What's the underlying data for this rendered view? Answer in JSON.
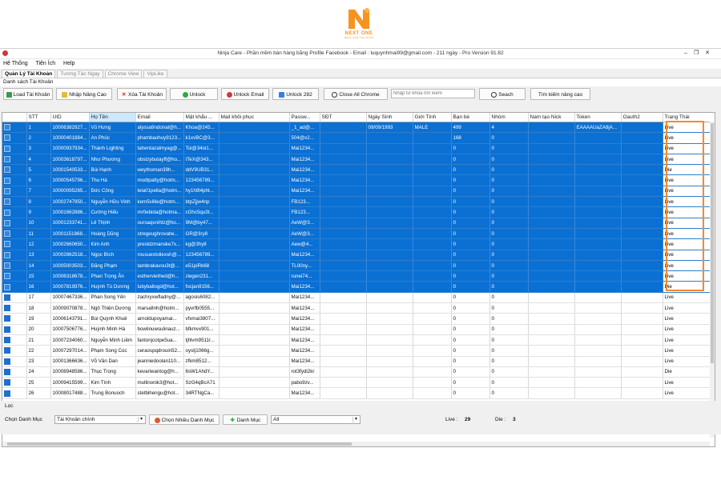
{
  "logo": {
    "brand": "NEXT ONE",
    "tagline": "NEXT ONE SOLUTION"
  },
  "window": {
    "title": "Ninja Care - Phần mềm bán hàng bằng Profile Facebook - Email : luquynhmai99@gmail.com - 211 ngày - Pro Version 91.82"
  },
  "menu": [
    "Hệ Thống",
    "Tiện Ích",
    "Help"
  ],
  "tabs": [
    "Quản Lý Tài Khoản",
    "Tương Tác Ngay",
    "Chrome View",
    "VipLike"
  ],
  "panel_title": "Danh sách Tài Khoản",
  "toolbar": {
    "load": "Load Tài Khoản",
    "import_adv": "Nhập Nâng Cao",
    "delete": "Xóa Tài Khoản",
    "unlock": "Unlock",
    "unlock_email": "Unlock Email",
    "unlock282": "Unlock 282",
    "close_chrome": "Close All Chrome",
    "search_placeholder": "Nhập từ khóa tìm kiếm",
    "search": "Seach",
    "adv_search": "Tìm kiếm nâng cao"
  },
  "columns": [
    "STT",
    "UID",
    "Họ Tên",
    "Email",
    "Mật khẩu ...",
    "Mail khôi phục",
    "Passw...",
    "SĐT",
    "Ngày Sinh",
    "Giới Tính",
    "Bạn bè",
    "Nhóm",
    "Nam tạo Nick",
    "Token",
    "Oauth2",
    "Trạng Thái"
  ],
  "rows": [
    [
      "1",
      "10006382927...",
      "Vũ Hưng",
      "alyssa9ndonal@h...",
      "Khoa@245...",
      "",
      "_1_ad@...",
      "",
      "09/09/1993",
      "MALE",
      "499",
      "4",
      "",
      "EAAAAUaZA8jA...",
      "",
      "Live"
    ],
    [
      "2",
      "10000401884...",
      "An Phúc",
      "phambaohuy9123...",
      "k1xvBC@3...",
      "",
      "504@x2...",
      "",
      "",
      "",
      "168",
      "0",
      "",
      "",
      "",
      "Live"
    ],
    [
      "3",
      "10000937934...",
      "Thành Lighting",
      "tahentazalmyag@...",
      "Toi@34oi1...",
      "",
      "Mai1234...",
      "",
      "",
      "",
      "0",
      "0",
      "",
      "",
      "",
      "Live"
    ],
    [
      "4",
      "10003618797...",
      "Như Phương",
      "obstzybutayff@ho...",
      "tTeX@343...",
      "",
      "Mai1234...",
      "",
      "",
      "",
      "0",
      "0",
      "",
      "",
      "",
      "Live"
    ],
    [
      "5",
      "10001540533...",
      "Bùi Hạnh",
      "weythoman39h...",
      "ddV9UB31...",
      "",
      "Mai1234...",
      "",
      "",
      "",
      "0",
      "0",
      "",
      "",
      "",
      "Die"
    ],
    [
      "6",
      "10000545796...",
      "Thu Hà",
      "modtpatty@hotm...",
      "123456789...",
      "",
      "Mai1234...",
      "",
      "",
      "",
      "0",
      "0",
      "",
      "",
      "",
      "Live"
    ],
    [
      "7",
      "10000095285...",
      "Đức Công",
      "lela01pella@hotm...",
      "hy1h9l4pht...",
      "",
      "Mai1234...",
      "",
      "",
      "",
      "0",
      "0",
      "",
      "",
      "",
      "Live"
    ],
    [
      "8",
      "10002747950...",
      "Nguyễn Hữu Vinh",
      "kem5villie@hotm...",
      "btpZjjw4np",
      "",
      "FB123...",
      "",
      "",
      "",
      "0",
      "0",
      "",
      "",
      "",
      "Live"
    ],
    [
      "9",
      "10001662886...",
      "Cường Hiếu",
      "mr0ebida@hotma...",
      "cGhc5qu3t...",
      "",
      "FB123...",
      "",
      "",
      "",
      "0",
      "0",
      "",
      "",
      "",
      "Live"
    ],
    [
      "10",
      "10001233741...",
      "Lê Thịnh",
      "oursaqsnihtz@ho...",
      "9M@by47...",
      "",
      "AeW@3...",
      "",
      "",
      "",
      "0",
      "0",
      "",
      "",
      "",
      "Live"
    ],
    [
      "11",
      "10001151868...",
      "Hoàng Dũng",
      "stregeughrovatw...",
      "GR@3ry8",
      "",
      "AeW@3...",
      "",
      "",
      "",
      "0",
      "0",
      "",
      "",
      "",
      "Live"
    ],
    [
      "12",
      "10002660650...",
      "Kim Anh",
      "prestdzmanske7x...",
      "kg@3hy8",
      "",
      "Aew@4...",
      "",
      "",
      "",
      "0",
      "0",
      "",
      "",
      "",
      "Live"
    ],
    [
      "13",
      "10002862518...",
      "Ngọc Bích",
      "rousuextollexsh@...",
      "123456789...",
      "",
      "Mai1234...",
      "",
      "",
      "",
      "0",
      "0",
      "",
      "",
      "",
      "Live"
    ],
    [
      "14",
      "10005003503...",
      "Đăng Phạm",
      "tambrakavou3t@...",
      "e51piRk68",
      "",
      "TL00ny...",
      "",
      "",
      "",
      "0",
      "0",
      "",
      "",
      "",
      "Live"
    ],
    [
      "15",
      "10006318678...",
      "Phan Trọng Ân",
      "estherviethed@h...",
      "ziegen231...",
      "",
      "runei74...",
      "",
      "",
      "",
      "0",
      "0",
      "",
      "",
      "",
      "Live"
    ],
    [
      "16",
      "10007819976...",
      "Huỳnh Tú Dương",
      "lubyballogd@hot...",
      "focjan9156...",
      "",
      "Mai1234...",
      "",
      "",
      "",
      "0",
      "0",
      "",
      "",
      "",
      "Die"
    ],
    [
      "17",
      "10007467336...",
      "Phan Song Yến",
      "zachryxwfladny@...",
      "agosis6082...",
      "",
      "Mai1234...",
      "",
      "",
      "",
      "0",
      "0",
      "",
      "",
      "",
      "Live"
    ],
    [
      "18",
      "10009070878...",
      "Ngô Thiện Dương",
      "marsallnh@hotm...",
      "pyvrfb0555...",
      "",
      "Mai1234...",
      "",
      "",
      "",
      "0",
      "0",
      "",
      "",
      "",
      "Live"
    ],
    [
      "19",
      "10006143791...",
      "Bùi Quỳnh Khuê",
      "arnoldupoyamai...",
      "vfxmai3807...",
      "",
      "Mai1234...",
      "",
      "",
      "",
      "0",
      "0",
      "",
      "",
      "",
      "Live"
    ],
    [
      "20",
      "10007506776...",
      "Huỳnh Minh Hà",
      "bowlinuwsulinauz...",
      "bfkmvx901...",
      "",
      "Mai1234...",
      "",
      "",
      "",
      "0",
      "0",
      "",
      "",
      "",
      "Live"
    ],
    [
      "21",
      "10007234060...",
      "Nguyễn Minh Liêm",
      "fantonjcotpe5ua...",
      "tjhlvm9511r...",
      "",
      "Mai1234...",
      "",
      "",
      "",
      "0",
      "0",
      "",
      "",
      "",
      "Live"
    ],
    [
      "22",
      "10007297014...",
      "Phạm Song Cúc",
      "ceraospqdrouin52...",
      "oystj1066g...",
      "",
      "Mai1234...",
      "",
      "",
      "",
      "0",
      "0",
      "",
      "",
      "",
      "Live"
    ],
    [
      "23",
      "10001366636...",
      "Võ Văn Dan",
      "jeanniedoolan110...",
      "zfkm8512...",
      "",
      "Mai1234...",
      "",
      "",
      "",
      "0",
      "0",
      "",
      "",
      "",
      "Live"
    ],
    [
      "24",
      "10008948586...",
      "Thục Trọng",
      "kevariwantog@h...",
      "6sW1AhdY...",
      "",
      "rot3fydi2kr",
      "",
      "",
      "",
      "0",
      "0",
      "",
      "",
      "",
      "Die"
    ],
    [
      "25",
      "10009415599...",
      "Kim Tính",
      "mullinonik3@hot...",
      "SzG4qBcA71",
      "",
      "pabo9zv...",
      "",
      "",
      "",
      "0",
      "0",
      "",
      "",
      "",
      "Live"
    ],
    [
      "26",
      "10008017488...",
      "Trung Bonuoch",
      "stetbihengu@hot...",
      "34RTNgCa...",
      "",
      "Mai1234...",
      "",
      "",
      "",
      "0",
      "0",
      "",
      "",
      "",
      "Live"
    ]
  ],
  "selected_count": 16,
  "filter": {
    "group_title": "Lọc",
    "choose_label": "Chọn Danh Mục",
    "category_value": "Tài Khoản chính",
    "multi_btn": "Chọn Nhiều Danh Mục",
    "add_btn": "Danh Mục",
    "all_value": "All",
    "live_label": "Live :",
    "live_count": "29",
    "die_label": "Die :",
    "die_count": "3"
  },
  "colors": {
    "selection": "#0a70d4",
    "highlight": "#f5892b",
    "brand": "#f7931e"
  }
}
